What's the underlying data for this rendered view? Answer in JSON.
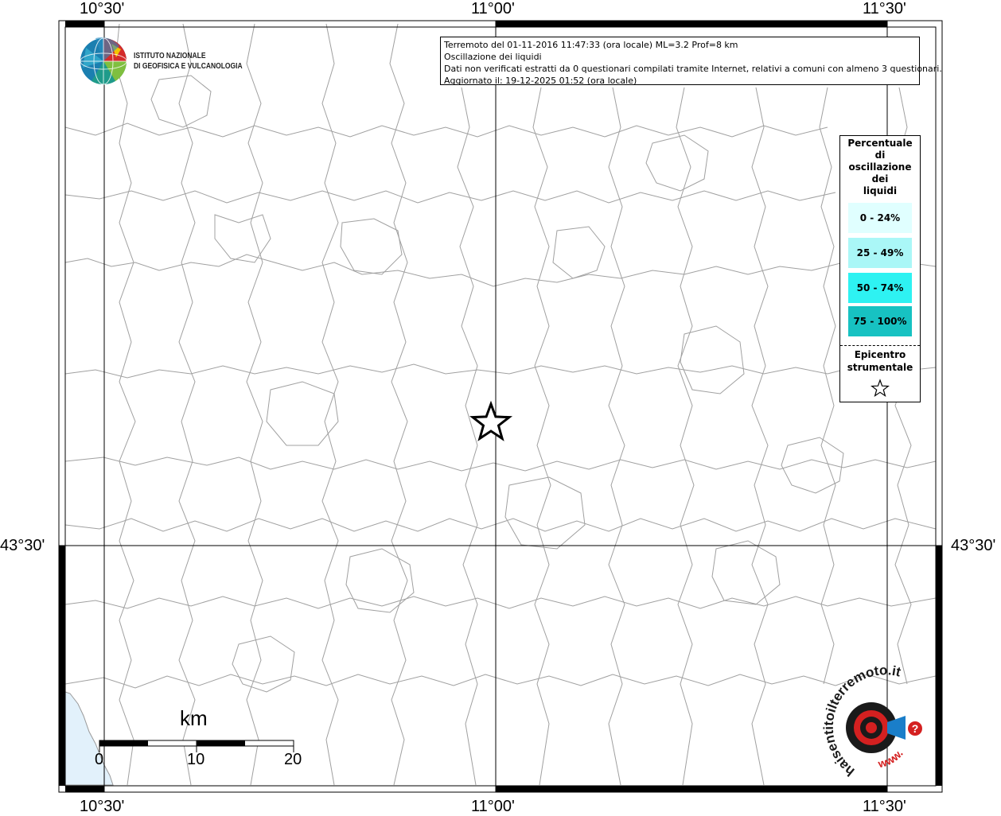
{
  "info": {
    "line1": "Terremoto del 01-11-2016 11:47:33 (ora locale) ML=3.2 Prof=8 km",
    "line2": "Oscillazione dei liquidi",
    "line3": "Dati non verificati estratti da 0 questionari compilati tramite Internet, relativi a comuni con almeno 3 questionari.",
    "line4": "Aggiornato il: 19-12-2025 01:52 (ora locale)"
  },
  "coords": {
    "top": [
      "10°30'",
      "11°00'",
      "11°30'"
    ],
    "bottom": [
      "10°30'",
      "11°00'",
      "11°30'"
    ],
    "left": "43°30'",
    "right": "43°30'"
  },
  "logo": {
    "line1": "ISTITUTO NAZIONALE",
    "line2": "DI GEOFISICA E VULCANOLOGIA"
  },
  "legend": {
    "title": [
      "Percentuale",
      "di",
      "oscillazione",
      "dei",
      "liquidi"
    ],
    "items": [
      {
        "label": "0 - 24%",
        "color": "#e0ffff"
      },
      {
        "label": "25 - 49%",
        "color": "#aaf7f7"
      },
      {
        "label": "50 - 74%",
        "color": "#2ef2f2"
      },
      {
        "label": "75 - 100%",
        "color": "#17c2c2"
      }
    ],
    "epicenter_label_1": "Epicentro",
    "epicenter_label_2": "strumentale"
  },
  "scale": {
    "unit": "km",
    "ticks": [
      "0",
      "10",
      "20"
    ]
  },
  "badge": {
    "text_outer": "haisentitoilterremoto.it",
    "text_inner": "www.",
    "question_mark": "?"
  },
  "colors": {
    "sea": "#e2f1fb",
    "boundary": "#9a9a9a",
    "grid": "#000000",
    "frame": "#000000",
    "badge_red": "#d42020",
    "badge_blue": "#1a7ec9"
  }
}
